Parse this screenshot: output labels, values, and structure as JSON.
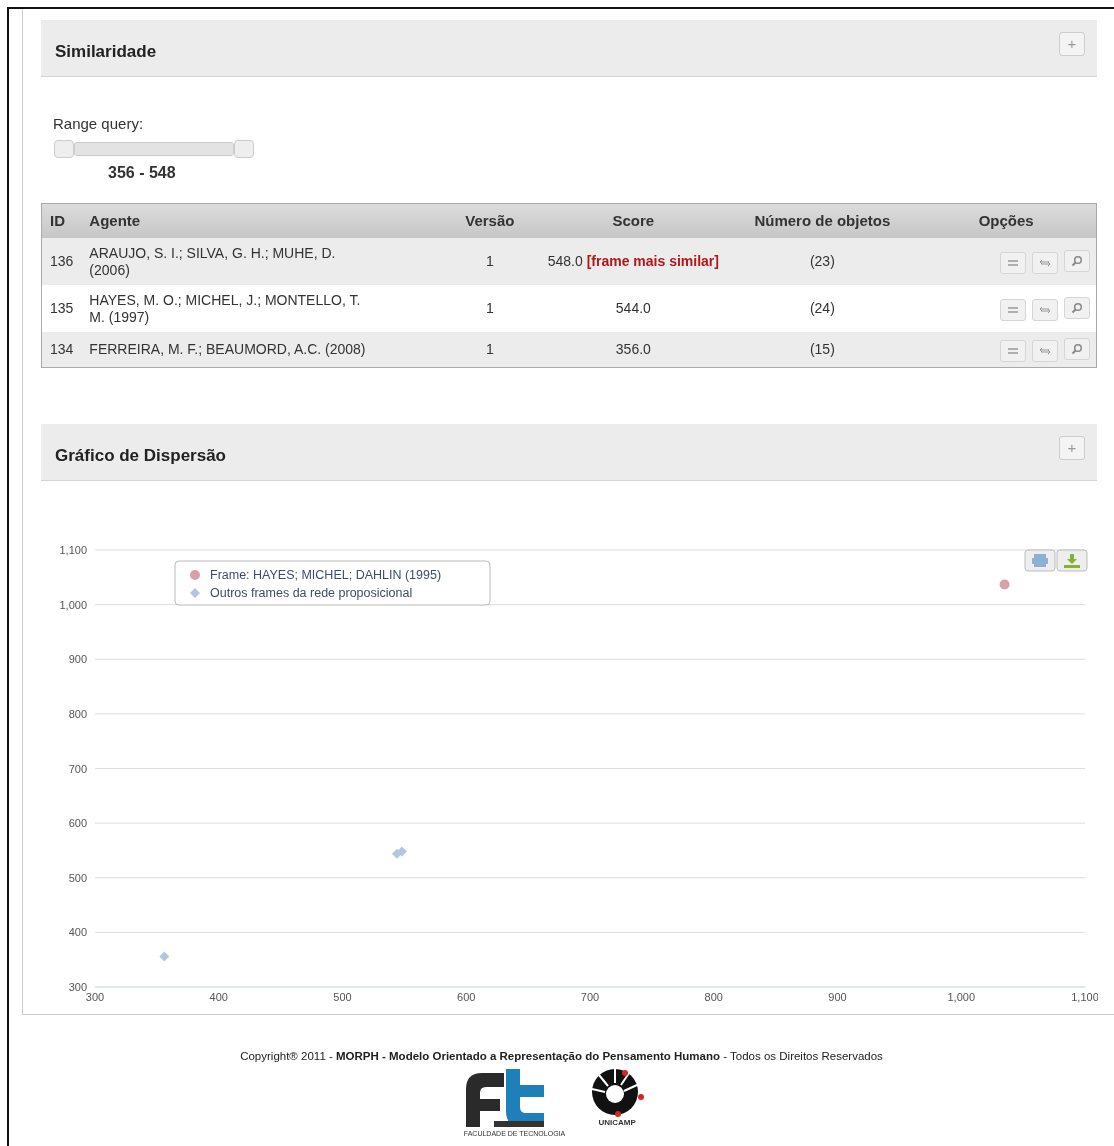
{
  "similarity_panel": {
    "title": "Similaridade",
    "expand_button": "+",
    "range_label": "Range query:",
    "range_value": "356 - 548",
    "table": {
      "columns": [
        "ID",
        "Agente",
        "Versão",
        "Score",
        "Número de objetos",
        "Opções"
      ],
      "rows": [
        {
          "id": "136",
          "agent": "ARAUJO, S. I.; SILVA, G. H.; MUHE, D. (2006)",
          "version": "1",
          "score": "548.0",
          "score_tag": "[frame mais similar]",
          "objects": "(23)"
        },
        {
          "id": "135",
          "agent": "HAYES, M. O.; MICHEL, J.; MONTELLO, T. M. (1997)",
          "version": "1",
          "score": "544.0",
          "objects": "(24)"
        },
        {
          "id": "134",
          "agent": "FERREIRA, M. F.; BEAUMORD, A.C. (2008)",
          "version": "1",
          "score": "356.0",
          "objects": "(15)"
        }
      ]
    }
  },
  "scatter_panel": {
    "title": "Gráfico de Dispersão",
    "expand_button": "+",
    "chart_data": {
      "type": "scatter",
      "grid": true,
      "legend": true,
      "xlim": [
        300,
        1100
      ],
      "ylim": [
        300,
        1100
      ],
      "xticks": [
        300,
        400,
        500,
        600,
        700,
        800,
        900,
        {
          "value": 1000,
          "label": "1,000"
        },
        {
          "value": 1100,
          "label": "1,100"
        }
      ],
      "yticks": [
        300,
        400,
        500,
        600,
        700,
        800,
        900,
        {
          "value": 1000,
          "label": "1,000"
        },
        {
          "value": 1100,
          "label": "1,100"
        }
      ],
      "series": [
        {
          "name": "Frame: HAYES; MICHEL; DAHLIN (1995)",
          "color": "#d9a0aa",
          "marker": "circle",
          "x": [
            1035
          ],
          "values": [
            1037
          ]
        },
        {
          "name": "Outros frames da rede proposicional",
          "color": "#b3c6e0",
          "marker": "diamond",
          "x": [
            356,
            544,
            548
          ],
          "values": [
            356,
            544,
            548
          ]
        }
      ]
    }
  },
  "footer": {
    "copyright": "Copyright® 2011 - **MORPH - Modelo Orientado a Representação do Pensamento Humano** - Todos os Direitos Reservados",
    "logo_caption_left": "FACULDADE DE TECNOLOGIA",
    "logo_caption_right": "UNICAMP"
  }
}
